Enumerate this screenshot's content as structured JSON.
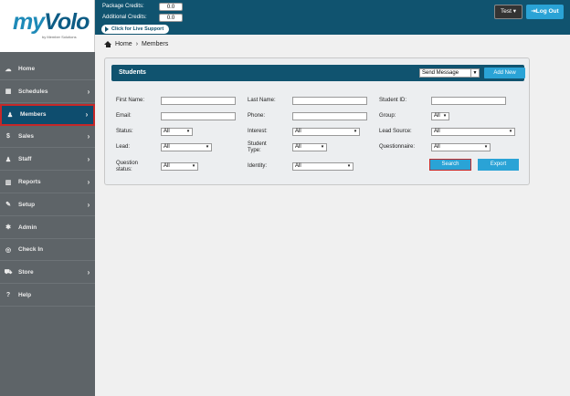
{
  "logo": {
    "brand_my": "my",
    "brand_volo": "Volo",
    "tagline": "by Member Solutions"
  },
  "sidebar": {
    "items": [
      {
        "label": "Home",
        "icon": "cloud-icon",
        "glyph": "☁",
        "chevron": false
      },
      {
        "label": "Schedules",
        "icon": "calendar-icon",
        "glyph": "▦",
        "chevron": true
      },
      {
        "label": "Members",
        "icon": "user-icon",
        "glyph": "♟",
        "chevron": true,
        "active": true
      },
      {
        "label": "Sales",
        "icon": "dollar-icon",
        "glyph": "$",
        "chevron": true
      },
      {
        "label": "Staff",
        "icon": "users-icon",
        "glyph": "♟",
        "chevron": true
      },
      {
        "label": "Reports",
        "icon": "chart-icon",
        "glyph": "▥",
        "chevron": true
      },
      {
        "label": "Setup",
        "icon": "wrench-icon",
        "glyph": "✎",
        "chevron": true
      },
      {
        "label": "Admin",
        "icon": "gear-icon",
        "glyph": "✱",
        "chevron": false
      },
      {
        "label": "Check In",
        "icon": "globe-icon",
        "glyph": "◎",
        "chevron": false
      },
      {
        "label": "Store",
        "icon": "cart-icon",
        "glyph": "⛟",
        "chevron": true
      },
      {
        "label": "Help",
        "icon": "question-icon",
        "glyph": "?",
        "chevron": false
      }
    ],
    "chevron_glyph": "›"
  },
  "topbar": {
    "package_credits_label": "Package Credits:",
    "package_credits_value": "0.0",
    "additional_credits_label": "Additional Credits:",
    "additional_credits_value": "0.0",
    "live_support": "Click for Live Support",
    "user_menu": "Test ▾",
    "logout": "Log Out",
    "logout_glyph": "⇥"
  },
  "breadcrumb": {
    "home": "Home",
    "sep": "›",
    "current": "Members"
  },
  "panel": {
    "title": "Students",
    "send_message": "Send Message",
    "add_new": "Add New",
    "fields": {
      "first_name": "First Name:",
      "last_name": "Last Name:",
      "student_id": "Student ID:",
      "email": "Email:",
      "phone": "Phone:",
      "group": "Group:",
      "group_value": "All",
      "status": "Status:",
      "status_value": "All",
      "interest": "Interest:",
      "interest_value": "All",
      "lead_source": "Lead Source:",
      "lead_source_value": "All",
      "lead": "Lead:",
      "lead_value": "All",
      "student_type_1": "Student",
      "student_type_2": "Type:",
      "student_type_value": "All",
      "questionnaire": "Questionnaire:",
      "questionnaire_value": "All",
      "question_status_1": "Question",
      "question_status_2": "status:",
      "question_status_value": "All",
      "identity": "Identity:",
      "identity_value": "All"
    },
    "search": "Search",
    "export": "Export"
  },
  "colors": {
    "brand_dark": "#10536f",
    "accent": "#2aa3d6",
    "sidebar": "#5e6468",
    "highlight": "#c62828"
  }
}
